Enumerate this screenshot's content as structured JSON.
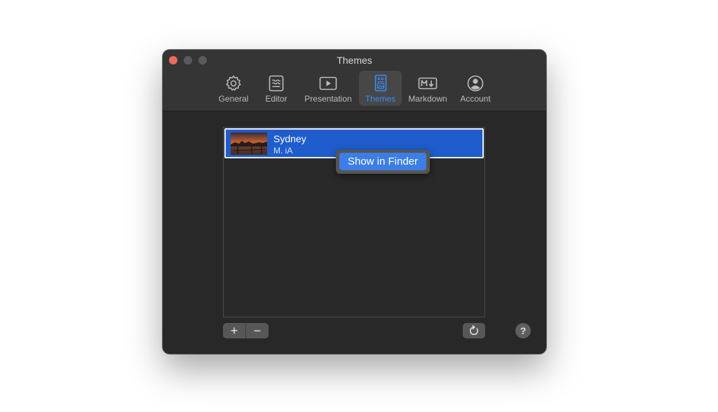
{
  "window": {
    "title": "Themes"
  },
  "toolbar": {
    "items": [
      {
        "label": "General",
        "icon": "gear-icon"
      },
      {
        "label": "Editor",
        "icon": "editor-icon"
      },
      {
        "label": "Presentation",
        "icon": "play-icon"
      },
      {
        "label": "Themes",
        "icon": "themes-icon",
        "active": true
      },
      {
        "label": "Markdown",
        "icon": "markdown-icon"
      },
      {
        "label": "Account",
        "icon": "account-icon"
      }
    ]
  },
  "themes": {
    "list": [
      {
        "name": "Sydney",
        "author": "M. iA",
        "selected": true
      }
    ]
  },
  "tooltip": {
    "label": "Show in Finder"
  },
  "controls": {
    "add_label": "+",
    "remove_label": "−",
    "help_label": "?"
  },
  "colors": {
    "accent": "#3c8cf2",
    "selection": "#1f5dcc",
    "close": "#ed6a5e"
  }
}
